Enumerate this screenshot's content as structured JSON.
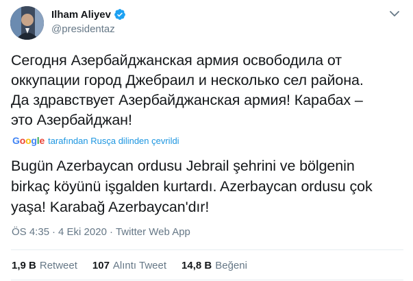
{
  "author": {
    "name": "Ilham Aliyev",
    "handle": "@presidentaz"
  },
  "tweet": {
    "text_ru": "Сегодня Азербайджанская армия освободила от\nоккупации город Джебраил и несколько сел района.\nДа здравствует Азербайджанская армия! Карабах –\nэто Азербайджан!",
    "translation_label": "tarafından Rusça dilinden çevrildi",
    "text_translated": "Bugün Azerbaycan ordusu Jebrail şehrini ve bölgenin\nbirkaç köyünü işgalden kurtardı. Azerbaycan ordusu çok\nyaşa! Karabağ Azerbaycan'dır!",
    "time": "ÖS 4:35",
    "sep1": "·",
    "date": "4 Eki 2020",
    "sep2": "·",
    "source": "Twitter Web App"
  },
  "stats": {
    "retweets": {
      "count": "1,9 B",
      "label": "Retweet"
    },
    "quotes": {
      "count": "107",
      "label": "Alıntı Tweet"
    },
    "likes": {
      "count": "14,8 B",
      "label": "Beğeni"
    }
  },
  "google_logo": {
    "g1": "G",
    "g2": "o",
    "g3": "o",
    "g4": "g",
    "g5": "l",
    "g6": "e"
  },
  "colors": {
    "link": "#1b95e0",
    "secondary": "#657786",
    "verified": "#1da1f2"
  },
  "icons": {
    "verified": "verified-badge-icon",
    "menu": "chevron-down-icon"
  }
}
